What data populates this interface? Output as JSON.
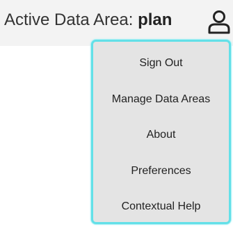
{
  "header": {
    "label": "Active Data Area: ",
    "data_area": "plan",
    "user_icon": "user-icon"
  },
  "user_menu": {
    "items": [
      {
        "label": "Sign Out"
      },
      {
        "label": "Manage Data Areas"
      },
      {
        "label": "About"
      },
      {
        "label": "Preferences"
      },
      {
        "label": "Contextual Help"
      }
    ]
  },
  "colors": {
    "menu_border": "#63e0e8",
    "menu_background": "#e4e4e4",
    "header_background": "#f3f3f3"
  }
}
